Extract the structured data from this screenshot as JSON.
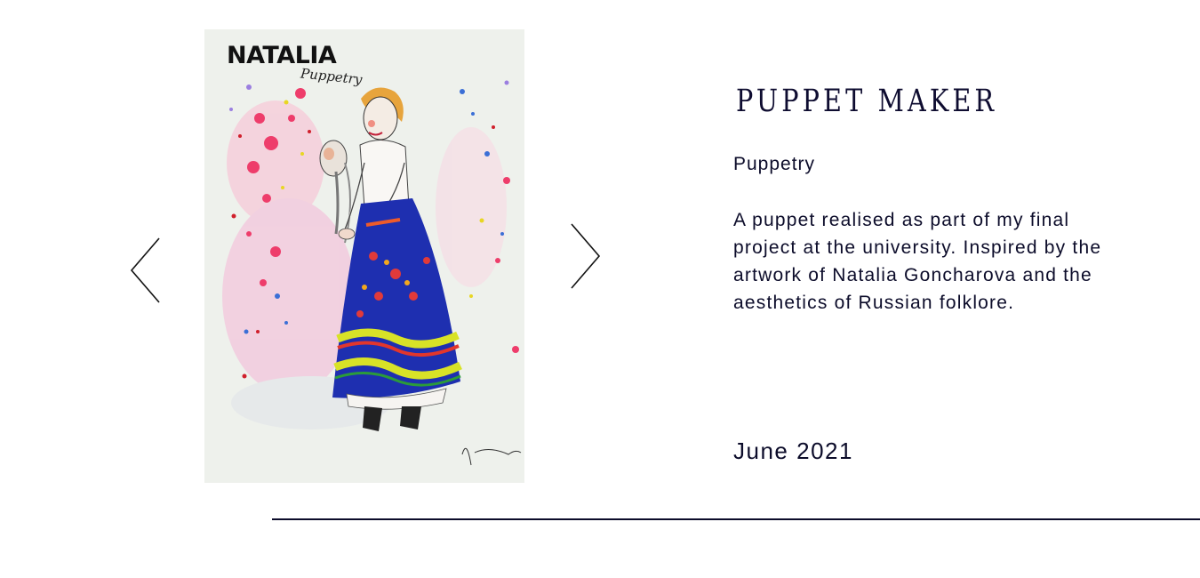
{
  "slide": {
    "title": "PUPPET MAKER",
    "category": "Puppetry",
    "description": "A puppet realised as part of my final project at the university. Inspired by the artwork of Natalia Goncharova and the aesthetics of Russian folklore.",
    "date": "June 2021"
  },
  "artwork": {
    "title": "NATALIA",
    "subtitle": "Puppetry"
  },
  "navigation": {
    "prev_icon": "chevron-left-icon",
    "next_icon": "chevron-right-icon"
  },
  "colors": {
    "text": "#0c0c2a",
    "background": "#ffffff",
    "skirt_blue": "#1e2fb0"
  }
}
